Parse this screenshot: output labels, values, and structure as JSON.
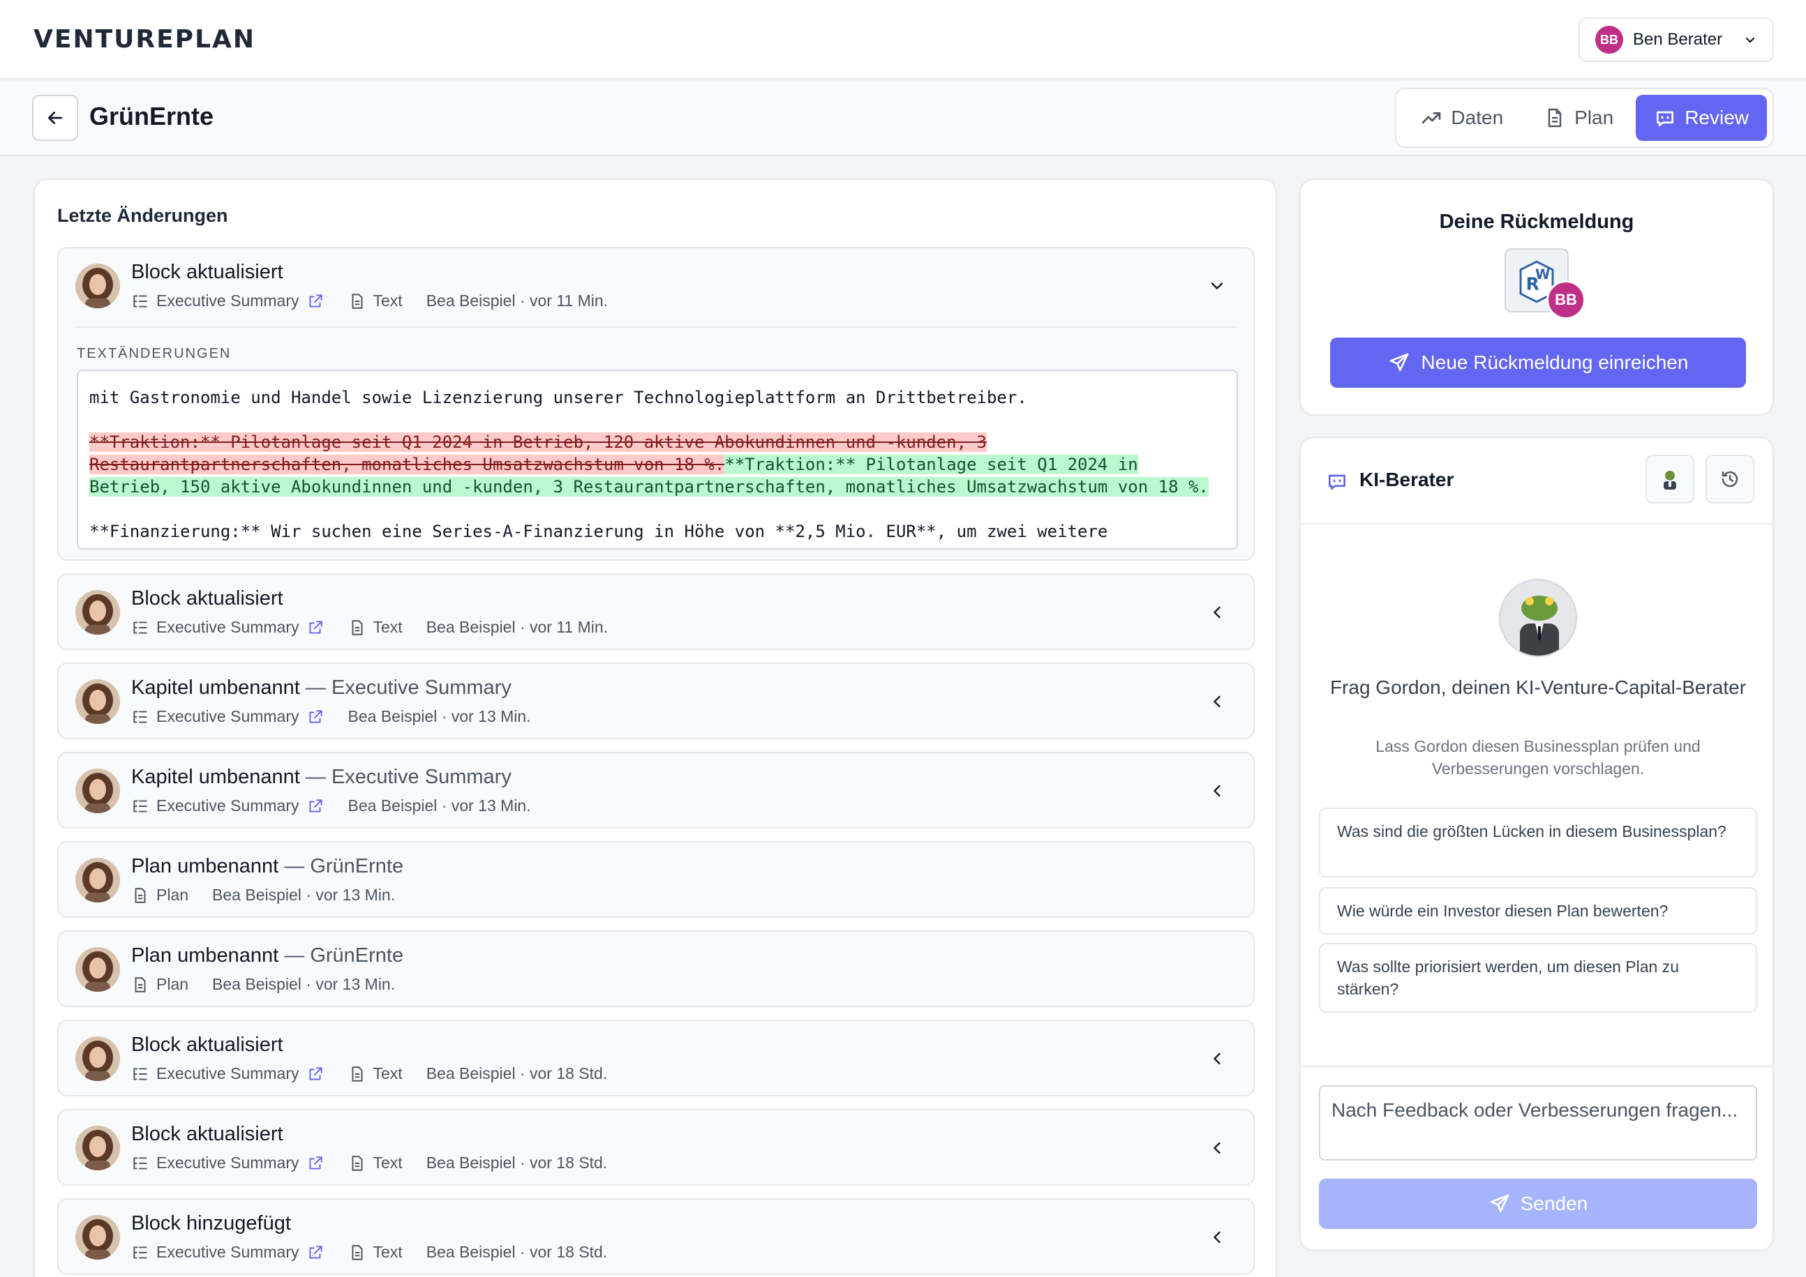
{
  "app": {
    "logo": "VENTUREPLAN"
  },
  "user": {
    "initials": "BB",
    "name": "Ben Berater"
  },
  "plan": {
    "title": "GrünErnte"
  },
  "tabs": [
    {
      "label": "Daten",
      "icon": "trend-icon"
    },
    {
      "label": "Plan",
      "icon": "document-icon"
    },
    {
      "label": "Review",
      "icon": "chat-bot-icon",
      "active": true
    }
  ],
  "changes": {
    "title": "Letzte Änderungen",
    "diff_label": "TEXTÄNDERUNGEN",
    "diff": {
      "context_top": "mit Gastronomie und Handel sowie Lizenzierung unserer Technologieplattform an Drittbetreiber.",
      "deleted": "**Traktion:** Pilotanlage seit Q1 2024 in Betrieb, 120 aktive Abokundinnen und -kunden, 3 Restaurantpartnerschaften, monatliches Umsatzwachstum von 18 %.",
      "inserted": "**Traktion:** Pilotanlage seit Q1 2024 in Betrieb, 150 aktive Abokundinnen und -kunden, 3 Restaurantpartnerschaften, monatliches Umsatzwachstum von 18 %.",
      "context_bottom": "**Finanzierung:** Wir suchen eine Series-A-Finanzierung in Höhe von **2,5 Mio. EUR**, um zwei weitere"
    },
    "entries": [
      {
        "title": "Block aktualisiert",
        "subtitle": "",
        "chapter": "Executive Summary",
        "type": "Text",
        "author_time": "Bea Beispiel · vor 11 Min.",
        "expanded": true
      },
      {
        "title": "Block aktualisiert",
        "subtitle": "",
        "chapter": "Executive Summary",
        "type": "Text",
        "author_time": "Bea Beispiel · vor 11 Min."
      },
      {
        "title": "Kapitel umbenannt",
        "subtitle": " — Executive Summary",
        "chapter": "Executive Summary",
        "type": "",
        "author_time": "Bea Beispiel · vor 13 Min."
      },
      {
        "title": "Kapitel umbenannt",
        "subtitle": " — Executive Summary",
        "chapter": "Executive Summary",
        "type": "",
        "author_time": "Bea Beispiel · vor 13 Min."
      },
      {
        "title": "Plan umbenannt",
        "subtitle": " — GrünErnte",
        "chapter": "",
        "type": "Plan",
        "author_time": "Bea Beispiel · vor 13 Min."
      },
      {
        "title": "Plan umbenannt",
        "subtitle": " — GrünErnte",
        "chapter": "",
        "type": "Plan",
        "author_time": "Bea Beispiel · vor 13 Min."
      },
      {
        "title": "Block aktualisiert",
        "subtitle": "",
        "chapter": "Executive Summary",
        "type": "Text",
        "author_time": "Bea Beispiel · vor 18 Std."
      },
      {
        "title": "Block aktualisiert",
        "subtitle": "",
        "chapter": "Executive Summary",
        "type": "Text",
        "author_time": "Bea Beispiel · vor 18 Std."
      },
      {
        "title": "Block hinzugefügt",
        "subtitle": "",
        "chapter": "Executive Summary",
        "type": "Text",
        "author_time": "Bea Beispiel · vor 18 Std."
      }
    ]
  },
  "feedback": {
    "title": "Deine Rückmeldung",
    "initials": "BB",
    "button": "Neue Rückmeldung einreichen"
  },
  "ai": {
    "title": "KI-Berater",
    "heading": "Frag Gordon, deinen KI-Venture-Capital-Berater",
    "subtitle": "Lass Gordon diesen Businessplan prüfen und Verbesserungen vorschlagen.",
    "suggestions": [
      "Was sind die größten Lücken in diesem Businessplan?",
      "Wie würde ein Investor diesen Plan bewerten?",
      "Was sollte priorisiert werden, um diesen Plan zu stärken?"
    ],
    "input_placeholder": "Nach Feedback oder Verbesserungen fragen...",
    "send": "Senden"
  },
  "colors": {
    "accent": "#6366f1",
    "accent_disabled": "#a5b4fc",
    "user_badge": "#be2f86",
    "del_bg": "#fecaca",
    "ins_bg": "#bbf7d0"
  }
}
